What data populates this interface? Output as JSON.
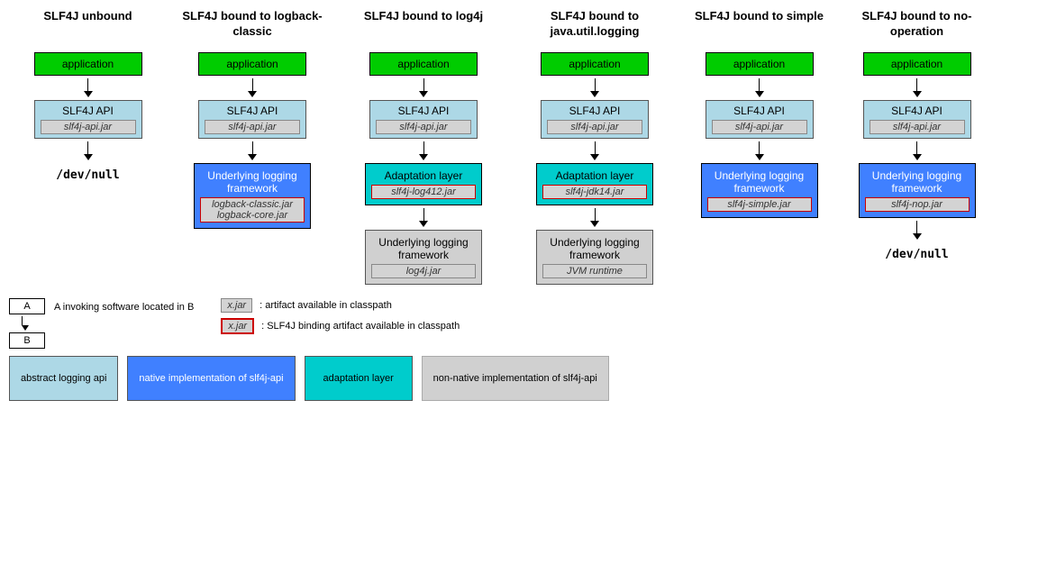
{
  "columns": [
    {
      "id": "col1",
      "title": "SLF4J unbound",
      "app": "application",
      "api_label": "SLF4J API",
      "api_jar": "slf4j-api.jar",
      "bottom": "devnull",
      "devnull_text": "/dev/null",
      "middle_box": null
    },
    {
      "id": "col2",
      "title": "SLF4J bound to logback-classic",
      "app": "application",
      "api_label": "SLF4J API",
      "api_jar": "slf4j-api.jar",
      "middle_box": {
        "type": "underlying",
        "label": "Underlying logging framework",
        "jars": [
          "logback-classic.jar",
          "logback-core.jar"
        ]
      },
      "bottom": null
    },
    {
      "id": "col3",
      "title": "SLF4J bound to log4j",
      "app": "application",
      "api_label": "SLF4J API",
      "api_jar": "slf4j-api.jar",
      "middle_box": {
        "type": "adapt",
        "label": "Adaptation layer",
        "jars": [
          "slf4j-log412.jar"
        ]
      },
      "bottom_box": {
        "type": "gray",
        "label": "Underlying logging framework",
        "jars": [
          "log4j.jar"
        ]
      }
    },
    {
      "id": "col4",
      "title": "SLF4J bound to java.util.logging",
      "app": "application",
      "api_label": "SLF4J API",
      "api_jar": "slf4j-api.jar",
      "middle_box": {
        "type": "adapt",
        "label": "Adaptation layer",
        "jars": [
          "slf4j-jdk14.jar"
        ]
      },
      "bottom_box": {
        "type": "gray",
        "label": "Underlying logging framework",
        "jars": [
          "JVM runtime"
        ]
      }
    },
    {
      "id": "col5",
      "title": "SLF4J bound to simple",
      "app": "application",
      "api_label": "SLF4J API",
      "api_jar": "slf4j-api.jar",
      "middle_box": {
        "type": "underlying",
        "label": "Underlying logging framework",
        "jars": [
          "slf4j-simple.jar"
        ]
      },
      "bottom": null
    },
    {
      "id": "col6",
      "title": "SLF4J bound to no-operation",
      "app": "application",
      "api_label": "SLF4J API",
      "api_jar": "slf4j-api.jar",
      "middle_box": {
        "type": "underlying",
        "label": "Underlying logging framework",
        "jars": [
          "slf4j-nop.jar"
        ]
      },
      "bottom": "devnull",
      "devnull_text": "/dev/null"
    }
  ],
  "legend": {
    "invoking_label": "A invoking software located in B",
    "a_label": "A",
    "b_label": "B",
    "artifact_normal_label": "x.jar",
    "artifact_normal_desc": ": artifact available in classpath",
    "artifact_binding_label": "x.jar",
    "artifact_binding_desc": ": SLF4J binding artifact available in classpath"
  },
  "color_legend": [
    {
      "color": "lightblue",
      "label": "abstract logging api"
    },
    {
      "color": "blue",
      "label": "native implementation of slf4j-api"
    },
    {
      "color": "cyan",
      "label": "adaptation layer"
    },
    {
      "color": "gray",
      "label": "non-native implementation of slf4j-api"
    }
  ]
}
